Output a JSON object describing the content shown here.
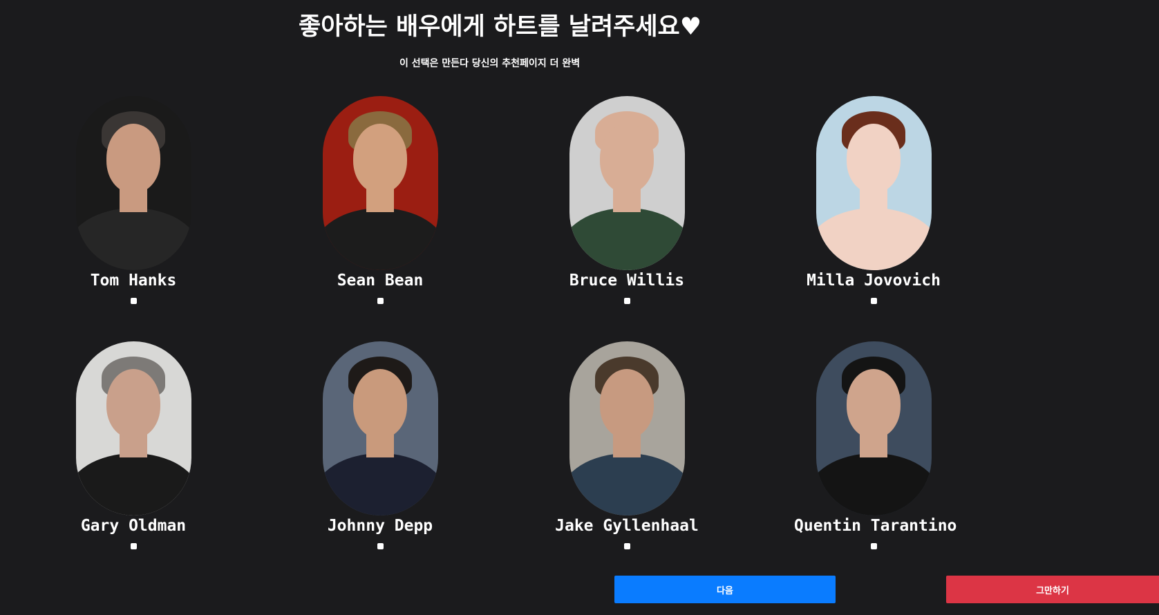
{
  "header": {
    "title": "좋아하는 배우에게 하트를 날려주세요♥",
    "subtitle": "이 선택은 만든다 당신의 추천페이지 더 완벽"
  },
  "actors": [
    {
      "name": "Tom Hanks",
      "bg": "#1a1a1a",
      "skin": "#c99a80",
      "hair": "#3a3634",
      "shirt": "#262626"
    },
    {
      "name": "Sean Bean",
      "bg": "#9b1e12",
      "skin": "#d2a07e",
      "hair": "#8a6a3e",
      "shirt": "#1c1c1c"
    },
    {
      "name": "Bruce Willis",
      "bg": "#cfcfcf",
      "skin": "#d8ad95",
      "hair": "#d8ad95",
      "shirt": "#2f4a36"
    },
    {
      "name": "Milla Jovovich",
      "bg": "#bcd6e4",
      "skin": "#f1d2c4",
      "hair": "#6a2e1c",
      "shirt": "#f1d2c4"
    },
    {
      "name": "Gary Oldman",
      "bg": "#d8d8d6",
      "skin": "#c9a08b",
      "hair": "#7d7a77",
      "shirt": "#1a1a1a"
    },
    {
      "name": "Johnny Depp",
      "bg": "#5a6678",
      "skin": "#c99a7c",
      "hair": "#1e1a18",
      "shirt": "#1c2030"
    },
    {
      "name": "Jake Gyllenhaal",
      "bg": "#a8a49c",
      "skin": "#c79a80",
      "hair": "#4a3a2c",
      "shirt": "#2c3e50"
    },
    {
      "name": "Quentin Tarantino",
      "bg": "#3e4c5e",
      "skin": "#cfa48c",
      "hair": "#141414",
      "shirt": "#141414"
    }
  ],
  "buttons": {
    "next_label": "다음",
    "stop_label": "그만하기"
  },
  "colors": {
    "background": "#1b1b1d",
    "next": "#0a7cff",
    "stop": "#dc3545",
    "text": "#ffffff"
  }
}
